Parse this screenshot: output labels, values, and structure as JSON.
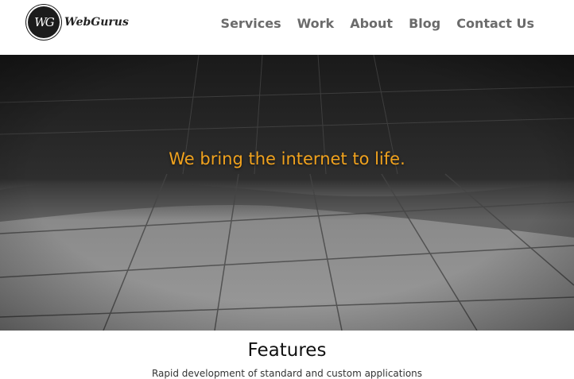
{
  "brand": {
    "mark": "WG",
    "name": "WebGurus"
  },
  "nav": {
    "items": [
      {
        "label": "Services"
      },
      {
        "label": "Work"
      },
      {
        "label": "About"
      },
      {
        "label": "Blog"
      },
      {
        "label": "Contact Us"
      }
    ]
  },
  "hero": {
    "title": "We bring the internet to life."
  },
  "features": {
    "title": "Features",
    "subtitle": "Rapid development of standard and custom applications"
  },
  "colors": {
    "accent": "#f0a21e",
    "nav_text": "#6b6b6b",
    "logo_dark": "#1c1c1c"
  },
  "icons": {
    "logo": "wg-monogram-logo-icon"
  }
}
